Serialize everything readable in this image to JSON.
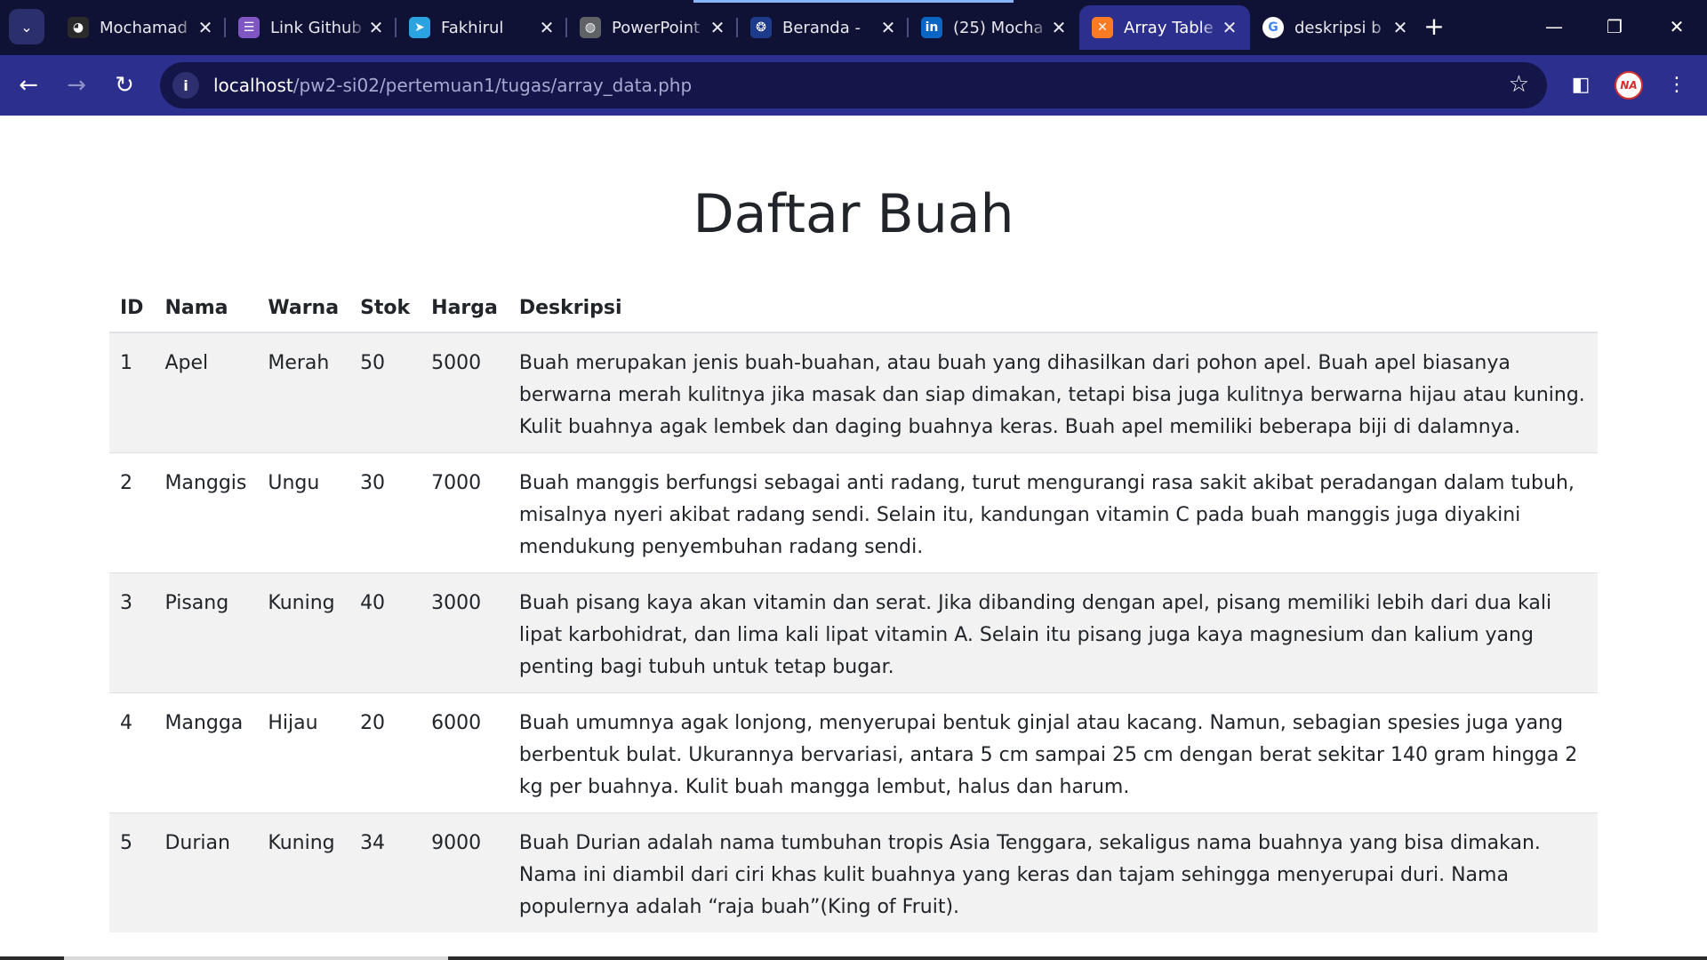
{
  "browser": {
    "tabs": [
      {
        "title": "Mochamad",
        "icon": "github-icon",
        "color": "#2a2a2a",
        "glyph": "◕"
      },
      {
        "title": "Link Github",
        "icon": "forms-icon",
        "color": "#7e57c2",
        "glyph": "☰"
      },
      {
        "title": "Fakhirul",
        "icon": "telegram-icon",
        "color": "#2aa3e0",
        "glyph": "➤"
      },
      {
        "title": "PowerPoint",
        "icon": "globe-icon",
        "color": "#5f6368",
        "glyph": "◍"
      },
      {
        "title": "Beranda -",
        "icon": "university-icon",
        "color": "#1e3a8a",
        "glyph": "❂"
      },
      {
        "title": "(25) Mocha",
        "icon": "linkedin-icon",
        "color": "#0a66c2",
        "glyph": "in"
      },
      {
        "title": "Array Table",
        "icon": "xampp-icon",
        "color": "#fb7a24",
        "glyph": "✕"
      },
      {
        "title": "deskripsi b",
        "icon": "google-icon",
        "color": "#ffffff",
        "glyph": "G"
      }
    ],
    "active_tab": 6,
    "url_host": "localhost",
    "url_path": "/pw2-si02/pertemuan1/tugas/array_data.php",
    "profile_initials": "NA"
  },
  "page": {
    "title": "Daftar Buah",
    "columns": [
      "ID",
      "Nama",
      "Warna",
      "Stok",
      "Harga",
      "Deskripsi"
    ],
    "rows": [
      {
        "id": "1",
        "nama": "Apel",
        "warna": "Merah",
        "stok": "50",
        "harga": "5000",
        "deskripsi": "Buah merupakan jenis buah-buahan, atau buah yang dihasilkan dari pohon apel. Buah apel biasanya berwarna merah kulitnya jika masak dan siap dimakan, tetapi bisa juga kulitnya berwarna hijau atau kuning. Kulit buahnya agak lembek dan daging buahnya keras. Buah apel memiliki beberapa biji di dalamnya."
      },
      {
        "id": "2",
        "nama": "Manggis",
        "warna": "Ungu",
        "stok": "30",
        "harga": "7000",
        "deskripsi": "Buah manggis berfungsi sebagai anti radang, turut mengurangi rasa sakit akibat peradangan dalam tubuh, misalnya nyeri akibat radang sendi. Selain itu, kandungan vitamin C pada buah manggis juga diyakini mendukung penyembuhan radang sendi."
      },
      {
        "id": "3",
        "nama": "Pisang",
        "warna": "Kuning",
        "stok": "40",
        "harga": "3000",
        "deskripsi": "Buah pisang kaya akan vitamin dan serat. Jika dibanding dengan apel, pisang memiliki lebih dari dua kali lipat karbohidrat, dan lima kali lipat vitamin A. Selain itu pisang juga kaya magnesium dan kalium yang penting bagi tubuh untuk tetap bugar."
      },
      {
        "id": "4",
        "nama": "Mangga",
        "warna": "Hijau",
        "stok": "20",
        "harga": "6000",
        "deskripsi": "Buah umumnya agak lonjong, menyerupai bentuk ginjal atau kacang. Namun, sebagian spesies juga yang berbentuk bulat. Ukurannya bervariasi, antara 5 cm sampai 25 cm dengan berat sekitar 140 gram hingga 2 kg per buahnya. Kulit buah mangga lembut, halus dan harum."
      },
      {
        "id": "5",
        "nama": "Durian",
        "warna": "Kuning",
        "stok": "34",
        "harga": "9000",
        "deskripsi": "Buah Durian adalah nama tumbuhan tropis Asia Tenggara, sekaligus nama buahnya yang bisa dimakan. Nama ini diambil dari ciri khas kulit buahnya yang keras dan tajam sehingga menyerupai duri. Nama populernya adalah “raja buah”(King of Fruit)."
      }
    ]
  }
}
